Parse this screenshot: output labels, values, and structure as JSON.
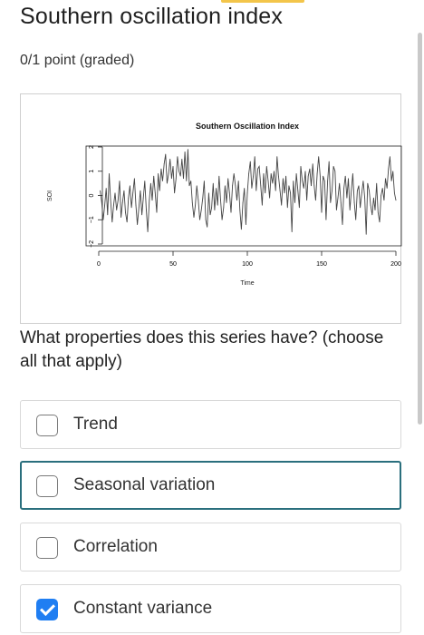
{
  "page": {
    "title": "Southern oscillation index",
    "points": "0/1 point (graded)",
    "question": "What properties does this series have? (choose all that apply)"
  },
  "options": [
    {
      "label": "Trend",
      "checked": false,
      "focused": false
    },
    {
      "label": "Seasonal variation",
      "checked": false,
      "focused": true
    },
    {
      "label": "Correlation",
      "checked": false,
      "focused": false
    },
    {
      "label": "Constant variance",
      "checked": true,
      "focused": false
    }
  ],
  "colors": {
    "accent": "#f3c54a",
    "focus_border": "#2a6f7d",
    "checkbox_checked": "#1f7ef2"
  },
  "chart_data": {
    "type": "line",
    "title": "Southern Oscillation Index",
    "xlabel": "Time",
    "ylabel": "SOI",
    "xlim": [
      1,
      200
    ],
    "ylim": [
      -2,
      2
    ],
    "xticks": [
      0,
      50,
      100,
      150,
      200
    ],
    "yticks": [
      -2,
      -1,
      0,
      1,
      2
    ],
    "grid": false,
    "x": [
      1,
      2,
      3,
      4,
      5,
      6,
      7,
      8,
      9,
      10,
      11,
      12,
      13,
      14,
      15,
      16,
      17,
      18,
      19,
      20,
      21,
      22,
      23,
      24,
      25,
      26,
      27,
      28,
      29,
      30,
      31,
      32,
      33,
      34,
      35,
      36,
      37,
      38,
      39,
      40,
      41,
      42,
      43,
      44,
      45,
      46,
      47,
      48,
      49,
      50,
      51,
      52,
      53,
      54,
      55,
      56,
      57,
      58,
      59,
      60,
      61,
      62,
      63,
      64,
      65,
      66,
      67,
      68,
      69,
      70,
      71,
      72,
      73,
      74,
      75,
      76,
      77,
      78,
      79,
      80,
      81,
      82,
      83,
      84,
      85,
      86,
      87,
      88,
      89,
      90,
      91,
      92,
      93,
      94,
      95,
      96,
      97,
      98,
      99,
      100,
      101,
      102,
      103,
      104,
      105,
      106,
      107,
      108,
      109,
      110,
      111,
      112,
      113,
      114,
      115,
      116,
      117,
      118,
      119,
      120,
      121,
      122,
      123,
      124,
      125,
      126,
      127,
      128,
      129,
      130,
      131,
      132,
      133,
      134,
      135,
      136,
      137,
      138,
      139,
      140,
      141,
      142,
      143,
      144,
      145,
      146,
      147,
      148,
      149,
      150,
      151,
      152,
      153,
      154,
      155,
      156,
      157,
      158,
      159,
      160,
      161,
      162,
      163,
      164,
      165,
      166,
      167,
      168,
      169,
      170,
      171,
      172,
      173,
      174,
      175,
      176,
      177,
      178,
      179,
      180,
      181,
      182,
      183,
      184,
      185,
      186,
      187,
      188,
      189,
      190,
      191,
      192,
      193,
      194,
      195,
      196,
      197,
      198,
      199,
      200
    ],
    "y": [
      0.2,
      -0.3,
      -1.0,
      -0.4,
      0.3,
      -0.8,
      0.9,
      -0.2,
      -1.1,
      -0.4,
      0.1,
      -0.6,
      -0.2,
      0.6,
      -0.9,
      -0.3,
      0.2,
      -0.7,
      -1.1,
      -0.1,
      0.4,
      -0.5,
      0.1,
      0.7,
      -0.4,
      -1.2,
      -0.5,
      0.2,
      -0.8,
      -0.1,
      0.6,
      -0.6,
      -1.5,
      -0.2,
      0.5,
      -0.2,
      0.8,
      0.1,
      -0.7,
      0.9,
      0.2,
      1.1,
      0.6,
      1.3,
      1.7,
      0.5,
      0.9,
      1.5,
      0.7,
      1.2,
      0.1,
      0.7,
      1.6,
      1.0,
      0.8,
      1.5,
      0.7,
      1.8,
      0.6,
      1.9,
      0.4,
      0.6,
      -0.3,
      -0.9,
      -0.4,
      0.4,
      -0.2,
      -1.0,
      -0.6,
      -0.1,
      0.6,
      -1.0,
      -1.3,
      0.1,
      -0.8,
      -0.5,
      0.5,
      -0.6,
      0.3,
      -0.4,
      0.8,
      -0.2,
      -1.0,
      -0.5,
      0.4,
      -0.3,
      0.7,
      0.1,
      -0.7,
      0.4,
      0.9,
      0.4,
      -0.2,
      0.6,
      -0.6,
      -1.4,
      -0.3,
      0.3,
      -1.2,
      0.1,
      0.9,
      1.4,
      0.3,
      0.8,
      1.6,
      0.2,
      1.1,
      1.2,
      0.4,
      -0.4,
      0.9,
      0.1,
      1.2,
      0.6,
      -0.1,
      0.9,
      0.5,
      1.0,
      0.2,
      1.6,
      0.8,
      0.2,
      -0.4,
      0.7,
      0.1,
      0.8,
      -0.5,
      0.4,
      0.1,
      -1.5,
      0.6,
      -0.3,
      0.9,
      0.2,
      -0.5,
      1.2,
      0.6,
      0.3,
      1.0,
      -0.2,
      0.8,
      1.1,
      0.4,
      1.3,
      0.4,
      -0.2,
      0.9,
      1.6,
      0.8,
      -0.7,
      0.8,
      0.6,
      -1.0,
      0.6,
      1.4,
      -0.3,
      0.2,
      1.2,
      1.0,
      -0.6,
      -0.1,
      0.5,
      -0.3,
      -1.2,
      0.3,
      0.8,
      -0.1,
      0.7,
      -0.6,
      0.2,
      0.9,
      -0.3,
      -1.0,
      0.2,
      0.4,
      -0.5,
      0.1,
      0.6,
      -0.1,
      -1.6,
      0.5,
      0.2,
      -0.4,
      -0.8,
      -0.1,
      -0.6,
      0.5,
      -0.7,
      -1.1,
      0.0,
      0.3,
      -0.2,
      0.7,
      0.3,
      1.1,
      1.6,
      0.6,
      1.0,
      0.1,
      -0.2
    ]
  }
}
